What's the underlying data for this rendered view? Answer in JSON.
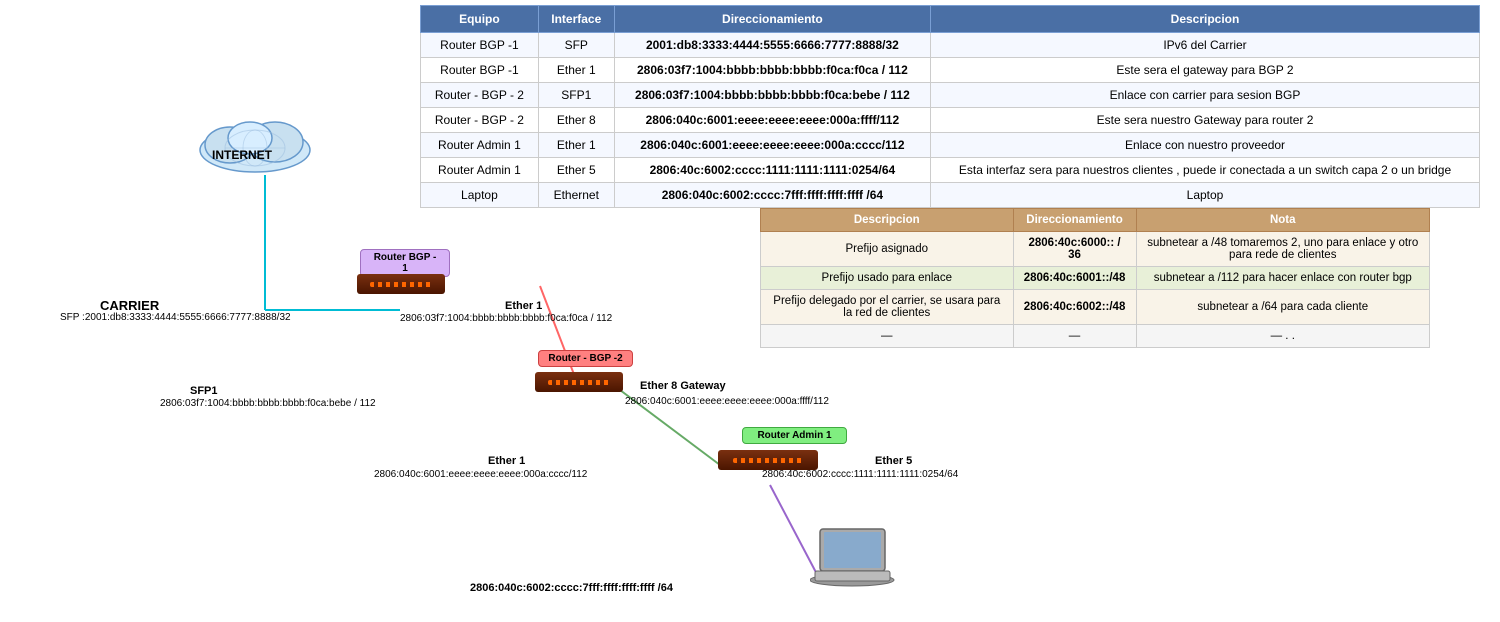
{
  "table": {
    "headers": [
      "Equipo",
      "Interface",
      "Direccionamiento",
      "Descripcion"
    ],
    "rows": [
      {
        "equipo": "Router BGP -1",
        "interface": "SFP",
        "direccionamiento": "2001:db8:3333:4444:5555:6666:7777:8888/32",
        "descripcion": "IPv6 del Carrier"
      },
      {
        "equipo": "Router BGP -1",
        "interface": "Ether 1",
        "direccionamiento": "2806:03f7:1004:bbbb:bbbb:bbbb:f0ca:f0ca / 112",
        "descripcion": "Este sera el gateway para BGP 2"
      },
      {
        "equipo": "Router - BGP - 2",
        "interface": "SFP1",
        "direccionamiento": "2806:03f7:1004:bbbb:bbbb:bbbb:f0ca:bebe / 112",
        "descripcion": "Enlace con carrier para sesion BGP"
      },
      {
        "equipo": "Router - BGP - 2",
        "interface": "Ether 8",
        "direccionamiento": "2806:040c:6001:eeee:eeee:eeee:000a:ffff/112",
        "descripcion": "Este sera nuestro Gateway para router 2"
      },
      {
        "equipo": "Router Admin 1",
        "interface": "Ether 1",
        "direccionamiento": "2806:040c:6001:eeee:eeee:eeee:000a:cccc/112",
        "descripcion": "Enlace con nuestro proveedor"
      },
      {
        "equipo": "Router Admin 1",
        "interface": "Ether 5",
        "direccionamiento": "2806:40c:6002:cccc:1111:1111:1111:0254/64",
        "descripcion": "Esta interfaz sera para nuestros clientes , puede ir conectada a un switch capa 2 o un bridge"
      },
      {
        "equipo": "Laptop",
        "interface": "Ethernet",
        "direccionamiento": "2806:040c:6002:cccc:7fff:ffff:ffff:ffff /64",
        "descripcion": "Laptop"
      }
    ]
  },
  "sec_table": {
    "headers": [
      "Descripcion",
      "Direccionamiento",
      "Nota"
    ],
    "rows": [
      {
        "descripcion": "Prefijo asignado",
        "direccionamiento": "2806:40c:6000:: / 36",
        "nota": "subnetear a /48  tomaremos 2, uno para enlace y otro para rede de clientes"
      },
      {
        "descripcion": "Prefijo usado para enlace",
        "direccionamiento": "2806:40c:6001::/48",
        "nota": "subnetear a /112 para hacer enlace con router bgp"
      },
      {
        "descripcion": "Prefijo delegado por el carrier, se usara para la red de clientes",
        "direccionamiento": "2806:40c:6002::/48",
        "nota": "subnetear a /64 para cada cliente"
      },
      {
        "descripcion": "—",
        "direccionamiento": "—",
        "nota": "— . ."
      }
    ]
  },
  "diagram": {
    "internet_label": "INTERNET",
    "carrier_label": "CARRIER",
    "carrier_sfp": "SFP :2001:db8:3333:4444:5555:6666:7777:8888/32",
    "router_bgp1_label": "Router BGP -\n1",
    "ether1_bgp1_label": "Ether 1",
    "ether1_bgp1_addr": "2806:03f7:1004:bbbb:bbbb:bbbb:f0ca:f0ca / 112",
    "router_bgp2_label": "Router - BGP -2",
    "sfp1_bgp2_label": "SFP1",
    "sfp1_bgp2_addr": "2806:03f7:1004:bbbb:bbbb:bbbb:f0ca:bebe / 112",
    "ether8_gw_label": "Ether 8 Gateway",
    "ether8_gw_addr": "2806:040c:6001:eeee:eeee:eeee:000a:ffff/112",
    "router_admin1_label": "Router Admin 1",
    "ether1_admin1_label": "Ether 1",
    "ether1_admin1_addr": "2806:040c:6001:eeee:eeee:eeee:000a:cccc/112",
    "ether5_label": "Ether 5",
    "ether5_addr": "2806:40c:6002:cccc:1111:1111:1111:0254/64",
    "laptop_addr": "2806:040c:6002:cccc:7fff:ffff:ffff:ffff /64"
  }
}
